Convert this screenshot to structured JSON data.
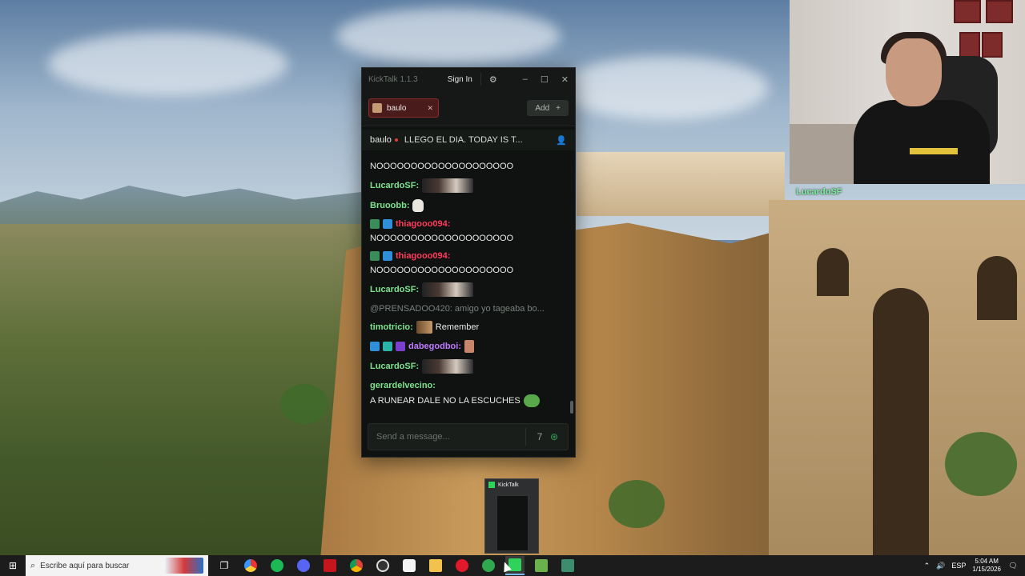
{
  "window": {
    "title": "KickTalk 1.1.3",
    "sign_in_label": "Sign In",
    "icons": {
      "settings": "gear-icon",
      "minimize": "minimize-icon",
      "maximize": "maximize-icon",
      "close": "close-icon"
    }
  },
  "tabs": [
    {
      "label": "baulo",
      "active": true
    }
  ],
  "add_button_label": "Add",
  "stream": {
    "channel": "baulo",
    "title": "LLEGO EL DIA. TODAY IS T...",
    "live": true
  },
  "chat": {
    "messages": [
      {
        "user": "",
        "text": "NOOOOOOOOOOOOOOOOOOOO"
      },
      {
        "user": "LucardoSF:",
        "text": "",
        "emote": "streamer-face-emote"
      },
      {
        "user": "Bruoobb:",
        "text": "",
        "emote": "skull-emote"
      },
      {
        "user": "thiagooo094:",
        "text": "NOOOOOOOOOOOOOOOOOOOO",
        "badges": [
          "badge-1",
          "badge-2"
        ]
      },
      {
        "user": "thiagooo094:",
        "text": "NOOOOOOOOOOOOOOOOOOOO",
        "badges": [
          "badge-1",
          "badge-2"
        ]
      },
      {
        "user": "LucardoSF:",
        "text": "",
        "emote": "streamer-face-emote"
      },
      {
        "reply": "@PRENSADOO420: amigo yo tageaba bo..."
      },
      {
        "user": "timotricio:",
        "text": "Remember",
        "emote": "small-emote"
      },
      {
        "user": "dabegodboi:",
        "text": "",
        "emote": "face-emote",
        "badges": [
          "badge-a",
          "badge-b",
          "badge-c"
        ]
      },
      {
        "user": "LucardoSF:",
        "text": "",
        "emote": "streamer-face-emote"
      },
      {
        "user": "gerardelvecino:",
        "text": "A RUNEAR DALE NO LA ESCUCHES",
        "emote": "frog-emote"
      }
    ]
  },
  "input": {
    "placeholder": "Send a message..."
  },
  "overlay_chat_text": "LucardoSF",
  "taskbar": {
    "search_placeholder": "Escribe aquí para buscar",
    "preview_title": "KickTalk",
    "language": "ESP",
    "time": "5:04 AM",
    "date": "1/15/2026"
  },
  "colors": {
    "accent_green": "#7ee38f",
    "kick_green": "#2fd35a",
    "username_red": "#ff3b5c"
  }
}
